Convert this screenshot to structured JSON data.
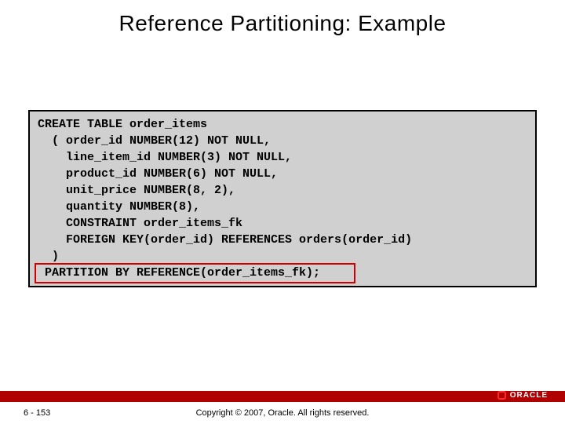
{
  "title": "Reference Partitioning: Example",
  "code": {
    "l1": "CREATE TABLE order_items",
    "l2": "  ( order_id NUMBER(12) NOT NULL,",
    "l3": "    line_item_id NUMBER(3) NOT NULL,",
    "l4": "    product_id NUMBER(6) NOT NULL,",
    "l5": "    unit_price NUMBER(8, 2),",
    "l6": "    quantity NUMBER(8),",
    "l7": "    CONSTRAINT order_items_fk",
    "l8": "    FOREIGN KEY(order_id) REFERENCES orders(order_id)",
    "l9": "  )",
    "l10": " PARTITION BY REFERENCE(order_items_fk);"
  },
  "footer": {
    "page": "6 - 153",
    "copyright": "Copyright © 2007, Oracle. All rights reserved.",
    "logo_text": "ORACLE"
  }
}
